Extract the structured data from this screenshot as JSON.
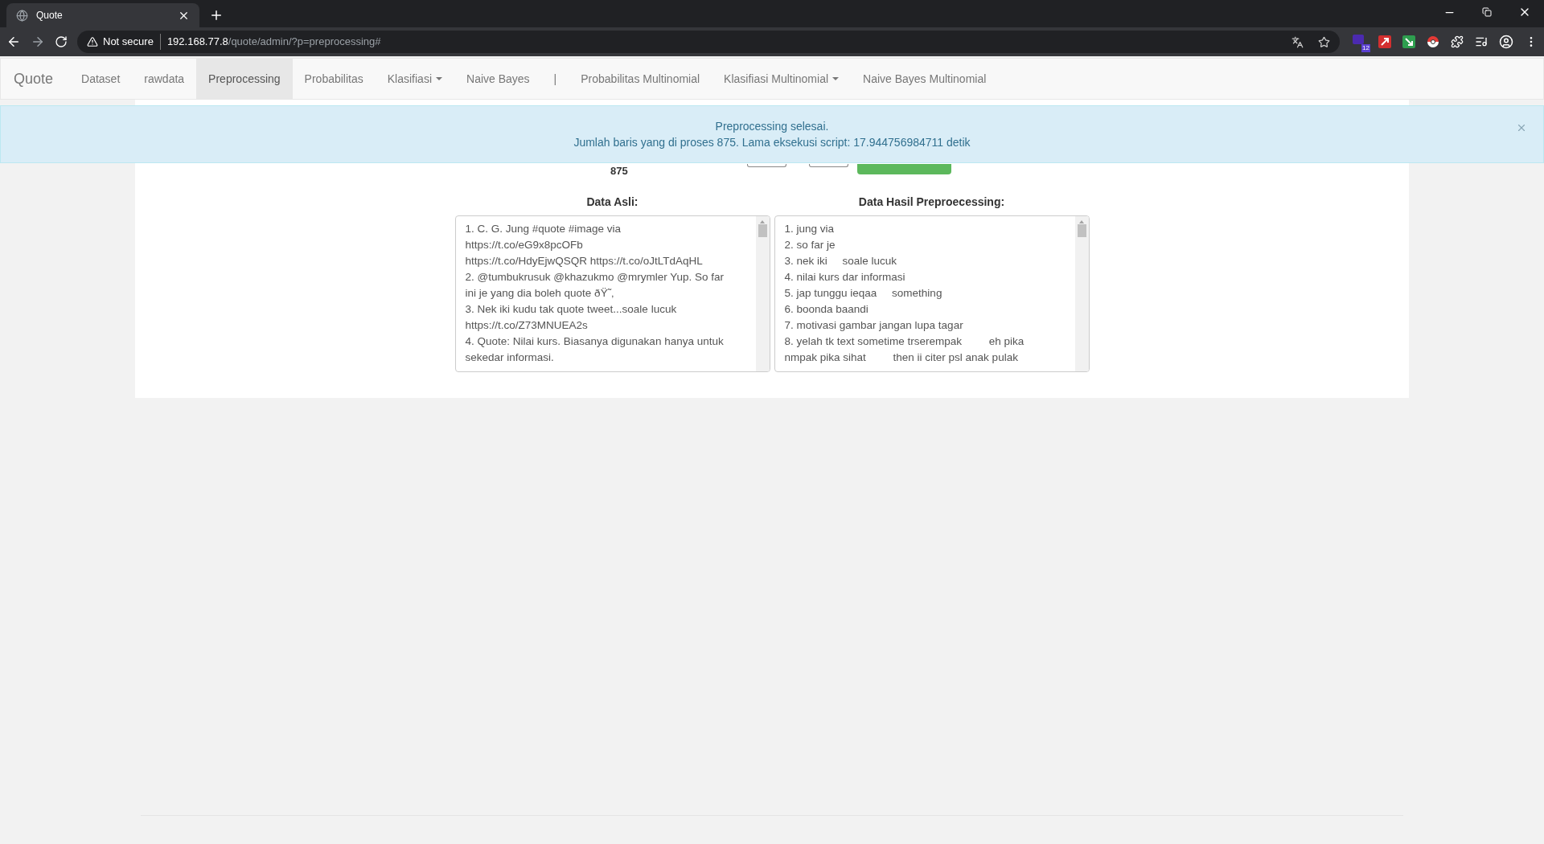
{
  "browser": {
    "tab_title": "Quote",
    "security_label": "Not secure",
    "url_host": "192.168.77.8",
    "url_path": "/quote/admin/?p=preprocessing#",
    "extension_badge": "12"
  },
  "navbar": {
    "brand": "Quote",
    "items": [
      {
        "label": "Dataset",
        "kind": "link",
        "selected": false
      },
      {
        "label": "rawdata",
        "kind": "link",
        "selected": false
      },
      {
        "label": "Preprocessing",
        "kind": "link",
        "selected": true
      },
      {
        "label": "Probabilitas",
        "kind": "link",
        "selected": false
      },
      {
        "label": "Klasifiasi",
        "kind": "dropdown",
        "selected": false
      },
      {
        "label": "Naive Bayes",
        "kind": "link",
        "selected": false
      },
      {
        "label": "|",
        "kind": "separator",
        "selected": false
      },
      {
        "label": "Probabilitas Multinomial",
        "kind": "link",
        "selected": false
      },
      {
        "label": "Klasifiasi Multinomial",
        "kind": "dropdown",
        "selected": false
      },
      {
        "label": "Naive Bayes Multinomial",
        "kind": "link",
        "selected": false
      }
    ]
  },
  "alert": {
    "title": "Preprocessing selesai.",
    "message": "Jumlah baris yang di proses 875. Lama eksekusi script: 17.944756984711 detik"
  },
  "count": "875",
  "panels": [
    {
      "label": "Data Asli:",
      "lines": [
        "1. C. G. Jung #quote #image via",
        "https://t.co/eG9x8pcOFb",
        "https://t.co/HdyEjwQSQR https://t.co/oJtLTdAqHL",
        "2. @tumbukrusuk @khazukmo @mrymler Yup. So far",
        "ini je yang dia boleh quote ðŸ˜‚",
        "3. Nek iki kudu tak quote tweet...soale lucuk",
        "https://t.co/Z73MNUEA2s",
        "4. Quote: Nilai kurs. Biasanya digunakan hanya untuk",
        "sekedar informasi."
      ]
    },
    {
      "label": "Data Hasil Preproecessing:",
      "lines": [
        "1. jung via",
        "2. so far je",
        "3. nek iki     soale lucuk",
        "4. nilai kurs dar informasi",
        "5. jap tunggu ieqaa     something",
        "6. boonda baandi",
        "7. motivasi gambar jangan lupa tagar",
        "8. yelah tk text sometime trserempak         eh pika",
        "nmpak pika sihat         then ii citer psl anak pulak"
      ]
    }
  ]
}
